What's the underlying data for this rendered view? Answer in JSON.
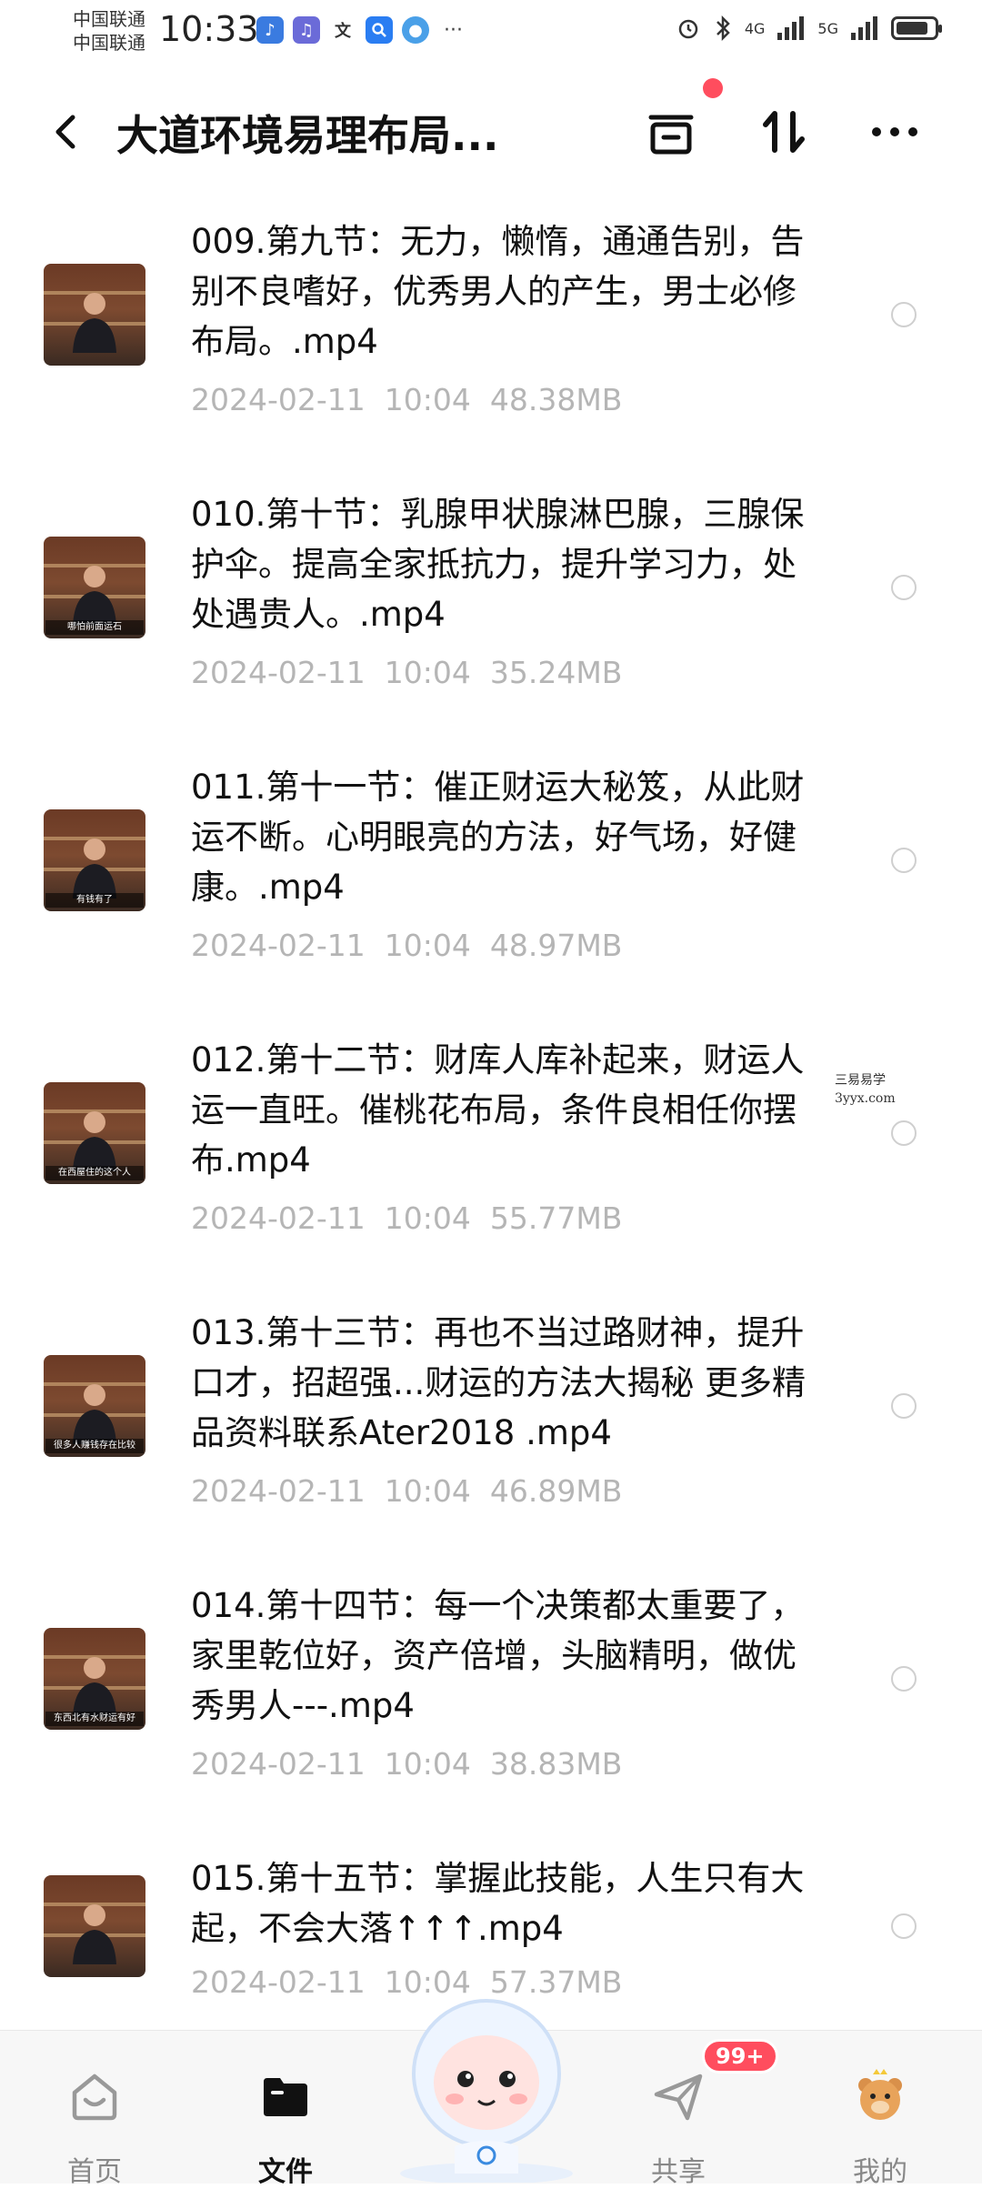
{
  "status_bar": {
    "carrier_1": "中国联通",
    "carrier_2": "中国联通",
    "time": "10:33",
    "signal_1": "4G",
    "signal_2": "5G",
    "battery_level": 0.85
  },
  "header": {
    "title": "大道环境易理布局..."
  },
  "files": [
    {
      "name": "009.第九节：无力，懒惰，通通告别，告别不良嗜好，优秀男人的产生，男士必修布局。.mp4",
      "date": "2024-02-11",
      "time": "10:04",
      "size": "48.38MB",
      "thumb_caption": ""
    },
    {
      "name": "010.第十节：乳腺甲状腺淋巴腺，三腺保护伞。提高全家抵抗力，提升学习力，处处遇贵人。.mp4",
      "date": "2024-02-11",
      "time": "10:04",
      "size": "35.24MB",
      "thumb_caption": "哪怕前面运石"
    },
    {
      "name": "011.第十一节：催正财运大秘笈，从此财运不断。心明眼亮的方法，好气场，好健康。.mp4",
      "date": "2024-02-11",
      "time": "10:04",
      "size": "48.97MB",
      "thumb_caption": "有钱有了"
    },
    {
      "name": "012.第十二节：财库人库补起来，财运人运一直旺。催桃花布局，条件良相任你摆布.mp4",
      "date": "2024-02-11",
      "time": "10:04",
      "size": "55.77MB",
      "thumb_caption": "在西屋住的这个人"
    },
    {
      "name": "013.第十三节：再也不当过路财神，提升口才，招超强...财运的方法大揭秘 更多精品资料联系Ater2018 .mp4",
      "date": "2024-02-11",
      "time": "10:04",
      "size": "46.89MB",
      "thumb_caption": "很多人赚钱存在比较"
    },
    {
      "name": "014.第十四节：每一个决策都太重要了，家里乾位好，资产倍增，头脑精明，做优秀男人---.mp4",
      "date": "2024-02-11",
      "time": "10:04",
      "size": "38.83MB",
      "thumb_caption": "东西北有水财运有好"
    },
    {
      "name": "015.第十五节：掌握此技能，人生只有大起，不会大落↑↑↑.mp4",
      "date": "2024-02-11",
      "time": "10:04",
      "size": "57.37MB",
      "thumb_caption": ""
    }
  ],
  "watermark": {
    "line1": "三易易学",
    "line2": "3yyx.com"
  },
  "nav": {
    "home": "首页",
    "files": "文件",
    "share": "共享",
    "mine": "我的",
    "share_badge": "99+"
  },
  "colors": {
    "accent_red": "#ff4d5e",
    "meta_gray": "#b5b5b5",
    "text": "#111111"
  }
}
